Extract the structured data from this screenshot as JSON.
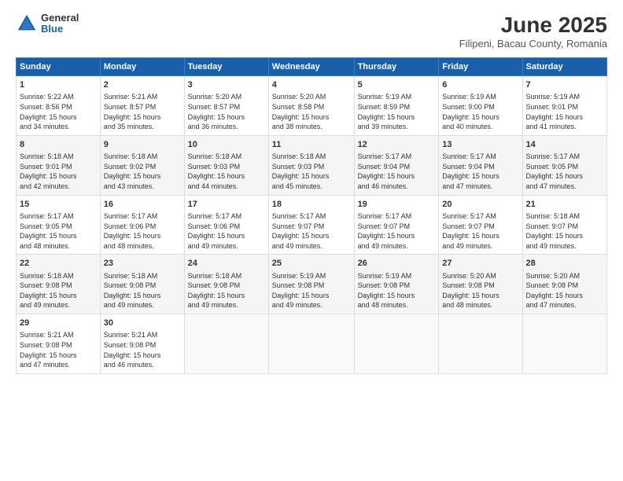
{
  "header": {
    "logo_general": "General",
    "logo_blue": "Blue",
    "month_title": "June 2025",
    "subtitle": "Filipeni, Bacau County, Romania"
  },
  "weekdays": [
    "Sunday",
    "Monday",
    "Tuesday",
    "Wednesday",
    "Thursday",
    "Friday",
    "Saturday"
  ],
  "weeks": [
    [
      {
        "day": "1",
        "info": "Sunrise: 5:22 AM\nSunset: 8:56 PM\nDaylight: 15 hours\nand 34 minutes."
      },
      {
        "day": "2",
        "info": "Sunrise: 5:21 AM\nSunset: 8:57 PM\nDaylight: 15 hours\nand 35 minutes."
      },
      {
        "day": "3",
        "info": "Sunrise: 5:20 AM\nSunset: 8:57 PM\nDaylight: 15 hours\nand 36 minutes."
      },
      {
        "day": "4",
        "info": "Sunrise: 5:20 AM\nSunset: 8:58 PM\nDaylight: 15 hours\nand 38 minutes."
      },
      {
        "day": "5",
        "info": "Sunrise: 5:19 AM\nSunset: 8:59 PM\nDaylight: 15 hours\nand 39 minutes."
      },
      {
        "day": "6",
        "info": "Sunrise: 5:19 AM\nSunset: 9:00 PM\nDaylight: 15 hours\nand 40 minutes."
      },
      {
        "day": "7",
        "info": "Sunrise: 5:19 AM\nSunset: 9:01 PM\nDaylight: 15 hours\nand 41 minutes."
      }
    ],
    [
      {
        "day": "8",
        "info": "Sunrise: 5:18 AM\nSunset: 9:01 PM\nDaylight: 15 hours\nand 42 minutes."
      },
      {
        "day": "9",
        "info": "Sunrise: 5:18 AM\nSunset: 9:02 PM\nDaylight: 15 hours\nand 43 minutes."
      },
      {
        "day": "10",
        "info": "Sunrise: 5:18 AM\nSunset: 9:03 PM\nDaylight: 15 hours\nand 44 minutes."
      },
      {
        "day": "11",
        "info": "Sunrise: 5:18 AM\nSunset: 9:03 PM\nDaylight: 15 hours\nand 45 minutes."
      },
      {
        "day": "12",
        "info": "Sunrise: 5:17 AM\nSunset: 9:04 PM\nDaylight: 15 hours\nand 46 minutes."
      },
      {
        "day": "13",
        "info": "Sunrise: 5:17 AM\nSunset: 9:04 PM\nDaylight: 15 hours\nand 47 minutes."
      },
      {
        "day": "14",
        "info": "Sunrise: 5:17 AM\nSunset: 9:05 PM\nDaylight: 15 hours\nand 47 minutes."
      }
    ],
    [
      {
        "day": "15",
        "info": "Sunrise: 5:17 AM\nSunset: 9:05 PM\nDaylight: 15 hours\nand 48 minutes."
      },
      {
        "day": "16",
        "info": "Sunrise: 5:17 AM\nSunset: 9:06 PM\nDaylight: 15 hours\nand 48 minutes."
      },
      {
        "day": "17",
        "info": "Sunrise: 5:17 AM\nSunset: 9:06 PM\nDaylight: 15 hours\nand 49 minutes."
      },
      {
        "day": "18",
        "info": "Sunrise: 5:17 AM\nSunset: 9:07 PM\nDaylight: 15 hours\nand 49 minutes."
      },
      {
        "day": "19",
        "info": "Sunrise: 5:17 AM\nSunset: 9:07 PM\nDaylight: 15 hours\nand 49 minutes."
      },
      {
        "day": "20",
        "info": "Sunrise: 5:17 AM\nSunset: 9:07 PM\nDaylight: 15 hours\nand 49 minutes."
      },
      {
        "day": "21",
        "info": "Sunrise: 5:18 AM\nSunset: 9:07 PM\nDaylight: 15 hours\nand 49 minutes."
      }
    ],
    [
      {
        "day": "22",
        "info": "Sunrise: 5:18 AM\nSunset: 9:08 PM\nDaylight: 15 hours\nand 49 minutes."
      },
      {
        "day": "23",
        "info": "Sunrise: 5:18 AM\nSunset: 9:08 PM\nDaylight: 15 hours\nand 49 minutes."
      },
      {
        "day": "24",
        "info": "Sunrise: 5:18 AM\nSunset: 9:08 PM\nDaylight: 15 hours\nand 49 minutes."
      },
      {
        "day": "25",
        "info": "Sunrise: 5:19 AM\nSunset: 9:08 PM\nDaylight: 15 hours\nand 49 minutes."
      },
      {
        "day": "26",
        "info": "Sunrise: 5:19 AM\nSunset: 9:08 PM\nDaylight: 15 hours\nand 48 minutes."
      },
      {
        "day": "27",
        "info": "Sunrise: 5:20 AM\nSunset: 9:08 PM\nDaylight: 15 hours\nand 48 minutes."
      },
      {
        "day": "28",
        "info": "Sunrise: 5:20 AM\nSunset: 9:08 PM\nDaylight: 15 hours\nand 47 minutes."
      }
    ],
    [
      {
        "day": "29",
        "info": "Sunrise: 5:21 AM\nSunset: 9:08 PM\nDaylight: 15 hours\nand 47 minutes."
      },
      {
        "day": "30",
        "info": "Sunrise: 5:21 AM\nSunset: 9:08 PM\nDaylight: 15 hours\nand 46 minutes."
      },
      {
        "day": "",
        "info": ""
      },
      {
        "day": "",
        "info": ""
      },
      {
        "day": "",
        "info": ""
      },
      {
        "day": "",
        "info": ""
      },
      {
        "day": "",
        "info": ""
      }
    ]
  ]
}
